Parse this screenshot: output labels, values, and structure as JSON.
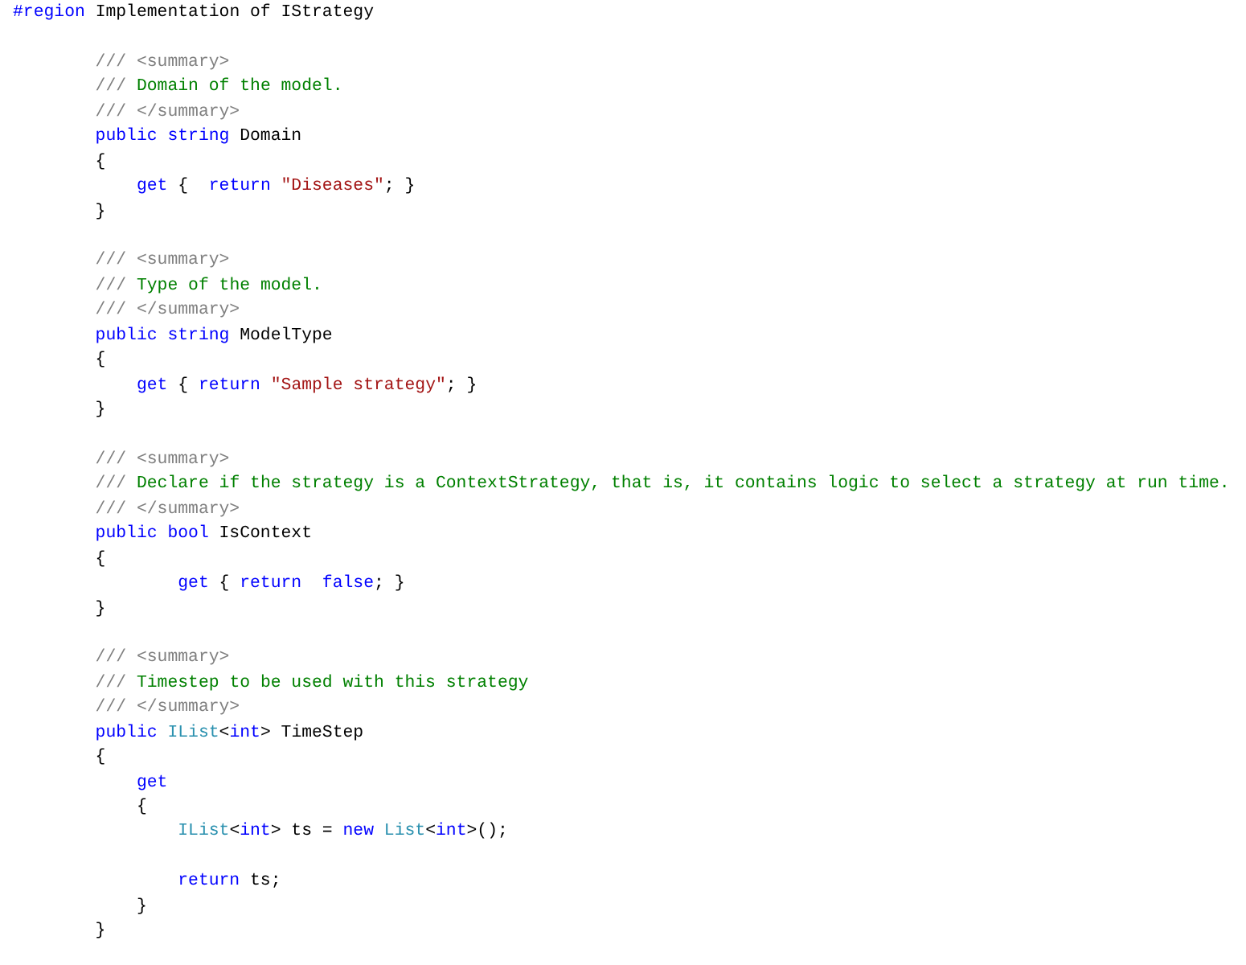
{
  "code_lines": [
    {
      "kind": "code",
      "tokens": [
        {
          "kind": "keyword",
          "text": "#region"
        },
        {
          "kind": "plain",
          "text": " Implementation of IStrategy"
        }
      ]
    },
    {
      "kind": "blank"
    },
    {
      "kind": "code",
      "tokens": [
        {
          "kind": "doc",
          "text": "        /// <summary>"
        }
      ]
    },
    {
      "kind": "code",
      "tokens": [
        {
          "kind": "doc",
          "text": "        ///"
        },
        {
          "kind": "comment",
          "text": " Domain of the model."
        }
      ]
    },
    {
      "kind": "code",
      "tokens": [
        {
          "kind": "doc",
          "text": "        /// </summary>"
        }
      ]
    },
    {
      "kind": "code",
      "tokens": [
        {
          "kind": "keyword",
          "text": "        public string"
        },
        {
          "kind": "plain",
          "text": " Domain"
        }
      ]
    },
    {
      "kind": "code",
      "tokens": [
        {
          "kind": "plain",
          "text": "        {"
        }
      ]
    },
    {
      "kind": "code",
      "tokens": [
        {
          "kind": "keyword",
          "text": "            get"
        },
        {
          "kind": "plain",
          "text": " {  "
        },
        {
          "kind": "keyword",
          "text": "return"
        },
        {
          "kind": "string",
          "text": " \"Diseases\""
        },
        {
          "kind": "plain",
          "text": "; }"
        }
      ]
    },
    {
      "kind": "code",
      "tokens": [
        {
          "kind": "plain",
          "text": "        }"
        }
      ]
    },
    {
      "kind": "blank"
    },
    {
      "kind": "code",
      "tokens": [
        {
          "kind": "doc",
          "text": "        /// <summary>"
        }
      ]
    },
    {
      "kind": "code",
      "tokens": [
        {
          "kind": "doc",
          "text": "        ///"
        },
        {
          "kind": "comment",
          "text": " Type of the model."
        }
      ]
    },
    {
      "kind": "code",
      "tokens": [
        {
          "kind": "doc",
          "text": "        /// </summary>"
        }
      ]
    },
    {
      "kind": "code",
      "tokens": [
        {
          "kind": "keyword",
          "text": "        public string"
        },
        {
          "kind": "plain",
          "text": " ModelType"
        }
      ]
    },
    {
      "kind": "code",
      "tokens": [
        {
          "kind": "plain",
          "text": "        {"
        }
      ]
    },
    {
      "kind": "code",
      "tokens": [
        {
          "kind": "keyword",
          "text": "            get"
        },
        {
          "kind": "plain",
          "text": " { "
        },
        {
          "kind": "keyword",
          "text": "return"
        },
        {
          "kind": "string",
          "text": " \"Sample strategy\""
        },
        {
          "kind": "plain",
          "text": "; }"
        }
      ]
    },
    {
      "kind": "code",
      "tokens": [
        {
          "kind": "plain",
          "text": "        }"
        }
      ]
    },
    {
      "kind": "blank"
    },
    {
      "kind": "code",
      "tokens": [
        {
          "kind": "doc",
          "text": "        /// <summary>"
        }
      ]
    },
    {
      "kind": "code",
      "tokens": [
        {
          "kind": "doc",
          "text": "        ///"
        },
        {
          "kind": "comment",
          "text": " Declare if the strategy is a ContextStrategy, that is, it contains logic to select a strategy at run time."
        }
      ]
    },
    {
      "kind": "code",
      "tokens": [
        {
          "kind": "doc",
          "text": "        /// </summary>"
        }
      ]
    },
    {
      "kind": "code",
      "tokens": [
        {
          "kind": "keyword",
          "text": "        public bool"
        },
        {
          "kind": "plain",
          "text": " IsContext"
        }
      ]
    },
    {
      "kind": "code",
      "tokens": [
        {
          "kind": "plain",
          "text": "        {"
        }
      ]
    },
    {
      "kind": "code",
      "tokens": [
        {
          "kind": "keyword",
          "text": "                get"
        },
        {
          "kind": "plain",
          "text": " { "
        },
        {
          "kind": "keyword",
          "text": "return  false"
        },
        {
          "kind": "plain",
          "text": "; }"
        }
      ]
    },
    {
      "kind": "code",
      "tokens": [
        {
          "kind": "plain",
          "text": "        }"
        }
      ]
    },
    {
      "kind": "blank"
    },
    {
      "kind": "code",
      "tokens": [
        {
          "kind": "doc",
          "text": "        /// <summary>"
        }
      ]
    },
    {
      "kind": "code",
      "tokens": [
        {
          "kind": "doc",
          "text": "        ///"
        },
        {
          "kind": "comment",
          "text": " Timestep to be used with this strategy"
        }
      ]
    },
    {
      "kind": "code",
      "tokens": [
        {
          "kind": "doc",
          "text": "        /// </summary>"
        }
      ]
    },
    {
      "kind": "code",
      "tokens": [
        {
          "kind": "keyword",
          "text": "        public"
        },
        {
          "kind": "type",
          "text": " IList"
        },
        {
          "kind": "plain",
          "text": "<"
        },
        {
          "kind": "keyword",
          "text": "int"
        },
        {
          "kind": "plain",
          "text": "> TimeStep"
        }
      ]
    },
    {
      "kind": "code",
      "tokens": [
        {
          "kind": "plain",
          "text": "        {"
        }
      ]
    },
    {
      "kind": "code",
      "tokens": [
        {
          "kind": "keyword",
          "text": "            get"
        }
      ]
    },
    {
      "kind": "code",
      "tokens": [
        {
          "kind": "plain",
          "text": "            {"
        }
      ]
    },
    {
      "kind": "code",
      "tokens": [
        {
          "kind": "type",
          "text": "                IList"
        },
        {
          "kind": "plain",
          "text": "<"
        },
        {
          "kind": "keyword",
          "text": "int"
        },
        {
          "kind": "plain",
          "text": "> ts = "
        },
        {
          "kind": "keyword",
          "text": "new"
        },
        {
          "kind": "type",
          "text": " List"
        },
        {
          "kind": "plain",
          "text": "<"
        },
        {
          "kind": "keyword",
          "text": "int"
        },
        {
          "kind": "plain",
          "text": ">();"
        }
      ]
    },
    {
      "kind": "blank"
    },
    {
      "kind": "code",
      "tokens": [
        {
          "kind": "keyword",
          "text": "                return"
        },
        {
          "kind": "plain",
          "text": " ts;"
        }
      ]
    },
    {
      "kind": "code",
      "tokens": [
        {
          "kind": "plain",
          "text": "            }"
        }
      ]
    },
    {
      "kind": "code",
      "tokens": [
        {
          "kind": "plain",
          "text": "        }"
        }
      ]
    }
  ]
}
